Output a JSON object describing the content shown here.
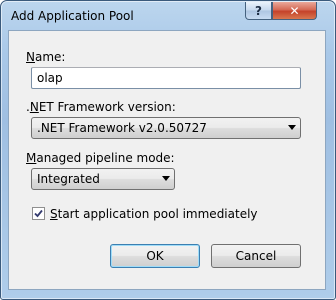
{
  "window": {
    "title": "Add Application Pool",
    "help_glyph": "?",
    "close_glyph": "✕"
  },
  "name": {
    "label_hotkey": "N",
    "label_rest": "ame:",
    "value": "olap"
  },
  "framework": {
    "label_pre": ".",
    "label_hotkey": "N",
    "label_rest": "ET Framework version:",
    "selected": ".NET Framework v2.0.50727"
  },
  "pipeline": {
    "label_hotkey": "M",
    "label_rest": "anaged pipeline mode:",
    "selected": "Integrated"
  },
  "start_immediately": {
    "checked": true,
    "label_hotkey": "S",
    "label_rest": "tart application pool immediately"
  },
  "buttons": {
    "ok": "OK",
    "cancel": "Cancel"
  }
}
